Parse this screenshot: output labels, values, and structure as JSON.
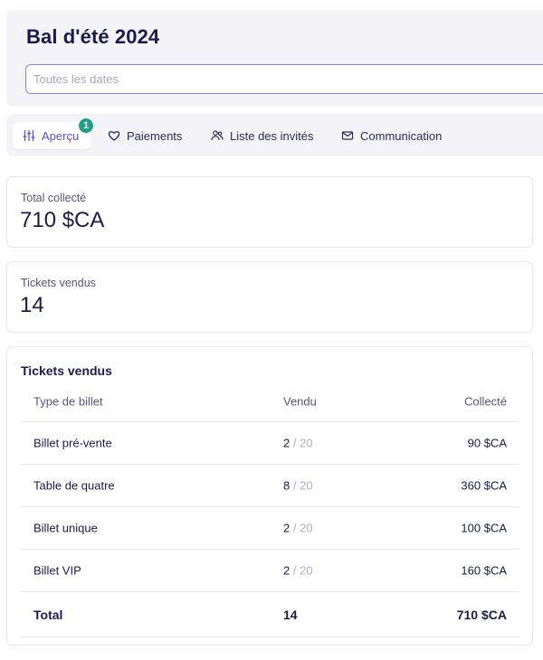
{
  "event": {
    "title": "Bal d'été 2024",
    "date_placeholder": "Toutes les dates"
  },
  "tabs": [
    {
      "label": "Aperçu",
      "icon": "sliders-icon",
      "active": true,
      "badge": "1"
    },
    {
      "label": "Paiements",
      "icon": "heart-icon"
    },
    {
      "label": "Liste des invités",
      "icon": "users-icon"
    },
    {
      "label": "Communication",
      "icon": "mail-icon"
    }
  ],
  "stats": {
    "total": {
      "label": "Total collecté",
      "value": "710 $CA"
    },
    "tickets": {
      "label": "Tickets vendus",
      "value": "14"
    }
  },
  "tickets_table": {
    "title": "Tickets vendus",
    "headers": [
      "Type de billet",
      "Vendu",
      "Collecté"
    ],
    "rows": [
      {
        "type": "Billet pré-vente",
        "sold": "2",
        "capacity": "/ 20",
        "collected": "90 $CA"
      },
      {
        "type": "Table de quatre",
        "sold": "8",
        "capacity": "/ 20",
        "collected": "360 $CA"
      },
      {
        "type": "Billet unique",
        "sold": "2",
        "capacity": "/ 20",
        "collected": "100 $CA"
      },
      {
        "type": "Billet VIP",
        "sold": "2",
        "capacity": "/ 20",
        "collected": "160 $CA"
      }
    ],
    "total": {
      "label": "Total",
      "sold": "14",
      "collected": "710 $CA"
    }
  },
  "colors": {
    "accent": "#5b4fd6",
    "badge": "#1e9e86",
    "text": "#1c1a4a",
    "panel": "#f4f4f8"
  }
}
